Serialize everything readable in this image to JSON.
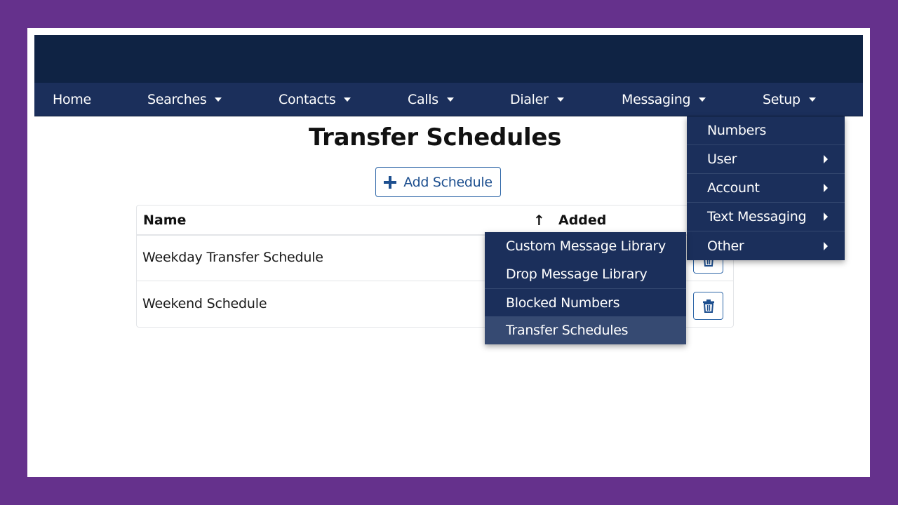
{
  "colors": {
    "page_border": "#65318c",
    "header_bg": "#0f2344",
    "nav_bg": "#1b2f5b",
    "accent": "#2f67a8",
    "active_item_bg": "#364a72"
  },
  "nav": {
    "items": [
      {
        "label": "Home",
        "has_caret": false
      },
      {
        "label": "Searches",
        "has_caret": true
      },
      {
        "label": "Contacts",
        "has_caret": true
      },
      {
        "label": "Calls",
        "has_caret": true
      },
      {
        "label": "Dialer",
        "has_caret": true
      },
      {
        "label": "Messaging",
        "has_caret": true
      },
      {
        "label": "Setup",
        "has_caret": true
      }
    ]
  },
  "page": {
    "title": "Transfer Schedules",
    "add_button_label": "Add Schedule",
    "add_button_icon": "plus-icon"
  },
  "table": {
    "columns": [
      {
        "label": "Name"
      },
      {
        "label": "Added",
        "sort_icon": "arrow-up-icon",
        "sort_glyph": "↑"
      }
    ],
    "rows": [
      {
        "name": "Weekday Transfer Schedule",
        "action_icon": "trash-icon"
      },
      {
        "name": "Weekend Schedule",
        "action_icon": "trash-icon"
      }
    ]
  },
  "setup_menu": {
    "items": [
      {
        "label": "Numbers",
        "has_submenu": false
      },
      {
        "label": "User",
        "has_submenu": true
      },
      {
        "label": "Account",
        "has_submenu": true
      },
      {
        "label": "Text Messaging",
        "has_submenu": true
      },
      {
        "label": "Other",
        "has_submenu": true
      }
    ]
  },
  "text_messaging_submenu": {
    "items": [
      {
        "label": "Custom Message Library"
      },
      {
        "label": "Drop Message Library"
      },
      {
        "label": "Blocked Numbers"
      },
      {
        "label": "Transfer Schedules",
        "active": true
      }
    ]
  }
}
